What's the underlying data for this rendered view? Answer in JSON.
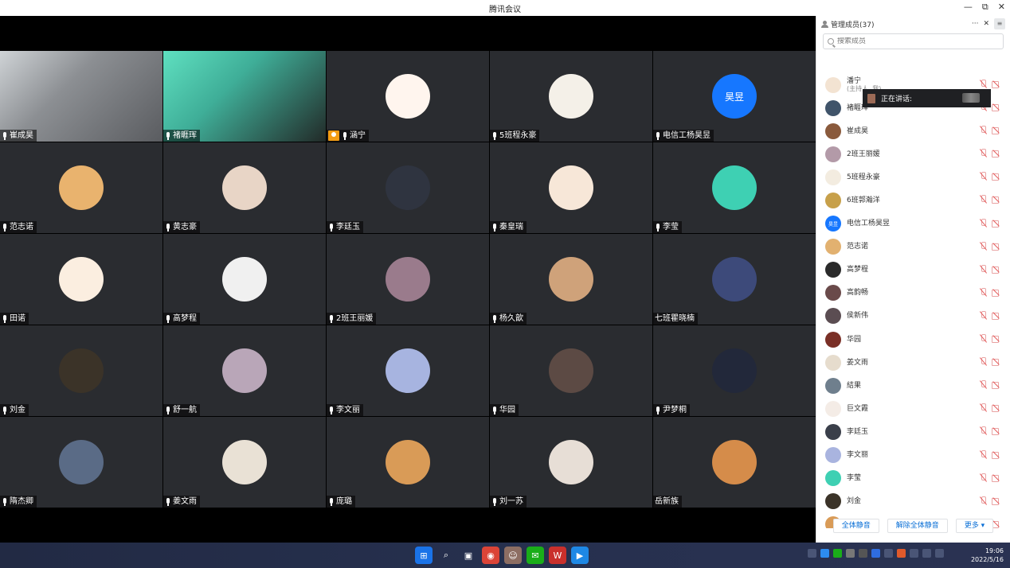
{
  "window": {
    "title": "腾讯会议",
    "min_label": "—",
    "max_label": "⧉",
    "close_label": "✕"
  },
  "grid": [
    {
      "name": "崔成昊",
      "kind": "video",
      "bg": "linear-gradient(135deg,#cfd3d6 0%,#8c8f93 40%,#5a5c60 100%)",
      "host": false
    },
    {
      "name": "褚睚珲",
      "kind": "video",
      "bg": "linear-gradient(135deg,#5fe0c0 0%,#3fae98 40%,#222a28 100%)",
      "host": false
    },
    {
      "name": "涵宁",
      "kind": "avatar",
      "bg": "#fff5ee",
      "avatar_text": "",
      "host": true
    },
    {
      "name": "5班程永豪",
      "kind": "avatar",
      "bg": "#f4f0e8",
      "avatar_text": "",
      "host": false
    },
    {
      "name": "电信工杨昊昱",
      "kind": "avatar",
      "bg": "#1677ff",
      "avatar_text": "昊昱",
      "host": false
    },
    {
      "name": "范志诺",
      "kind": "avatar",
      "bg": "#e9b36e",
      "avatar_text": "",
      "host": false
    },
    {
      "name": "黄志豪",
      "kind": "avatar",
      "bg": "#e8d5c6",
      "avatar_text": "",
      "host": false
    },
    {
      "name": "李廷玉",
      "kind": "avatar",
      "bg": "#2f3440",
      "avatar_text": "",
      "host": false
    },
    {
      "name": "秦皇瑞",
      "kind": "avatar",
      "bg": "#f7e7d8",
      "avatar_text": "",
      "host": false
    },
    {
      "name": "李莹",
      "kind": "avatar",
      "bg": "#3ed0b3",
      "avatar_text": "",
      "host": false
    },
    {
      "name": "田诺",
      "kind": "avatar",
      "bg": "#fbeee0",
      "avatar_text": "",
      "host": false
    },
    {
      "name": "高梦程",
      "kind": "avatar",
      "bg": "#f0f0f0",
      "avatar_text": "",
      "host": false
    },
    {
      "name": "2班王丽媛",
      "kind": "avatar",
      "bg": "#9a7b8c",
      "avatar_text": "",
      "host": false
    },
    {
      "name": "杨久歆",
      "kind": "avatar",
      "bg": "#cfa27a",
      "avatar_text": "",
      "host": false
    },
    {
      "name": "七班瞿晓楠",
      "kind": "avatar",
      "bg": "#3d4a7a",
      "avatar_text": "",
      "host": false,
      "no_mic": true
    },
    {
      "name": "刘金",
      "kind": "avatar",
      "bg": "#3b3328",
      "avatar_text": "",
      "host": false
    },
    {
      "name": "舒一航",
      "kind": "avatar",
      "bg": "#b9a6b8",
      "avatar_text": "",
      "host": false
    },
    {
      "name": "李文丽",
      "kind": "avatar",
      "bg": "#a7b4e0",
      "avatar_text": "",
      "host": false
    },
    {
      "name": "华园",
      "kind": "avatar",
      "bg": "#5c4a44",
      "avatar_text": "",
      "host": false
    },
    {
      "name": "尹梦桐",
      "kind": "avatar",
      "bg": "#22283a",
      "avatar_text": "",
      "host": false
    },
    {
      "name": "隋杰卿",
      "kind": "avatar",
      "bg": "#5a6b86",
      "avatar_text": "",
      "host": false
    },
    {
      "name": "姜文雨",
      "kind": "avatar",
      "bg": "#e9e1d5",
      "avatar_text": "",
      "host": false
    },
    {
      "name": "庞璐",
      "kind": "avatar",
      "bg": "#d99b57",
      "avatar_text": "",
      "host": false
    },
    {
      "name": "刘一苏",
      "kind": "avatar",
      "bg": "#e7ded6",
      "avatar_text": "",
      "host": false
    },
    {
      "name": "岳新族",
      "kind": "avatar",
      "bg": "#d58c4a",
      "avatar_text": "",
      "host": false,
      "no_mic": true
    }
  ],
  "panel": {
    "title": "管理成员(37)",
    "more_label": "···",
    "close_label": "✕",
    "toggle_label": "≡",
    "search_placeholder": "搜索成员",
    "speaking_label": "正在讲话:",
    "footer": {
      "mute_all": "全体静音",
      "unmute_all": "解除全体静音",
      "more": "更多 ▾"
    },
    "members": [
      {
        "name": "潘宁",
        "sub": "(主持人, 我)",
        "bg": "#f3e3d2"
      },
      {
        "name": "褚睚珲",
        "sub": "",
        "bg": "#40546a"
      },
      {
        "name": "崔成昊",
        "sub": "",
        "bg": "#8a5a3c"
      },
      {
        "name": "2班王丽媛",
        "sub": "",
        "bg": "#b39aa8"
      },
      {
        "name": "5班程永豪",
        "sub": "",
        "bg": "#f3ece0"
      },
      {
        "name": "6班郭瀚洋",
        "sub": "",
        "bg": "#c7a04a"
      },
      {
        "name": "电信工杨昊昱",
        "sub": "",
        "bg": "#1677ff",
        "text": "昊昱"
      },
      {
        "name": "范志诺",
        "sub": "",
        "bg": "#e2b170"
      },
      {
        "name": "高梦程",
        "sub": "",
        "bg": "#2a2a2a"
      },
      {
        "name": "高韵畅",
        "sub": "",
        "bg": "#6a4a4a"
      },
      {
        "name": "侯新伟",
        "sub": "",
        "bg": "#5b4d52"
      },
      {
        "name": "华园",
        "sub": "",
        "bg": "#7a2f26"
      },
      {
        "name": "姜文雨",
        "sub": "",
        "bg": "#e6dccd"
      },
      {
        "name": "結果",
        "sub": "",
        "bg": "#6f7f8d"
      },
      {
        "name": "巨文霞",
        "sub": "",
        "bg": "#f4ece6"
      },
      {
        "name": "李廷玉",
        "sub": "",
        "bg": "#3a3f4a"
      },
      {
        "name": "李文丽",
        "sub": "",
        "bg": "#a9b4df"
      },
      {
        "name": "李莹",
        "sub": "",
        "bg": "#3ed0b3"
      },
      {
        "name": "刘金",
        "sub": "",
        "bg": "#3b3328"
      },
      {
        "name": "庞璐",
        "sub": "",
        "bg": "#d99b57"
      }
    ]
  },
  "taskbar": {
    "time": "19:06",
    "date": "2022/5/16",
    "apps": [
      {
        "name": "windows-start",
        "bg": "#1a73e8",
        "glyph": "⊞"
      },
      {
        "name": "search",
        "bg": "transparent",
        "glyph": "⌕"
      },
      {
        "name": "task-view",
        "bg": "transparent",
        "glyph": "▣"
      },
      {
        "name": "chrome",
        "bg": "#db4437",
        "glyph": "◉"
      },
      {
        "name": "avatar-app",
        "bg": "#8d6e63",
        "glyph": "☺"
      },
      {
        "name": "wechat",
        "bg": "#1aad19",
        "glyph": "✉"
      },
      {
        "name": "wps",
        "bg": "#c9302c",
        "glyph": "W"
      },
      {
        "name": "tencent-meeting",
        "bg": "#1e88e5",
        "glyph": "▶"
      }
    ]
  }
}
